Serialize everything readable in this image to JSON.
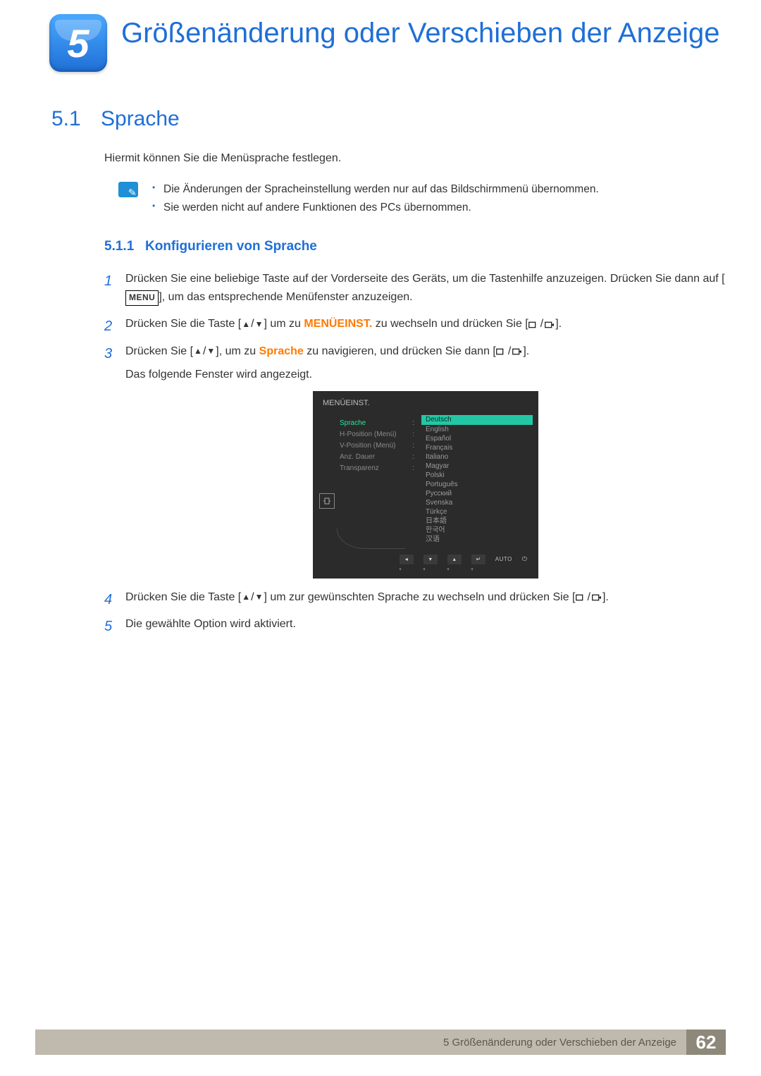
{
  "chapter": {
    "number": "5",
    "title": "Größenänderung oder Verschieben der Anzeige"
  },
  "section": {
    "number": "5.1",
    "title": "Sprache",
    "intro": "Hiermit können Sie die Menüsprache festlegen."
  },
  "notes": [
    "Die Änderungen der Spracheinstellung werden nur auf das Bildschirmmenü übernommen.",
    "Sie werden nicht auf andere Funktionen des PCs übernommen."
  ],
  "subsection": {
    "number": "5.1.1",
    "title": "Konfigurieren von Sprache"
  },
  "steps": {
    "s1a": "Drücken Sie eine beliebige Taste auf der Vorderseite des Geräts, um die Tastenhilfe anzuzeigen. Drücken Sie dann auf [",
    "s1b": "], um das entsprechende Menüfenster anzuzeigen.",
    "menu_label": "MENU",
    "s2a": "Drücken Sie die Taste [",
    "s2b": "] um zu ",
    "s2_hl": "MENÜEINST.",
    "s2c": " zu wechseln und drücken Sie [",
    "s2d": "].",
    "s3a": "Drücken Sie [",
    "s3b": "], um zu ",
    "s3_hl": "Sprache",
    "s3c": " zu navigieren, und drücken Sie dann [",
    "s3d": "].",
    "s3e": "Das folgende Fenster wird angezeigt.",
    "s4a": "Drücken Sie die Taste [",
    "s4b": "] um zur gewünschten Sprache zu wechseln und drücken Sie [",
    "s4c": "].",
    "s5": "Die gewählte Option wird aktiviert."
  },
  "osd": {
    "title": "MENÜEINST.",
    "left": [
      "Sprache",
      "H-Position (Menü)",
      "V-Position (Menü)",
      "Anz. Dauer",
      "Transparenz"
    ],
    "languages": [
      "Deutsch",
      "English",
      "Español",
      "Français",
      "Italiano",
      "Magyar",
      "Polski",
      "Português",
      "Русский",
      "Svenska",
      "Türkçe",
      "日本語",
      "한국어",
      "汉语"
    ],
    "auto": "AUTO"
  },
  "footer": {
    "text": "5 Größenänderung oder Verschieben der Anzeige",
    "page": "62"
  }
}
